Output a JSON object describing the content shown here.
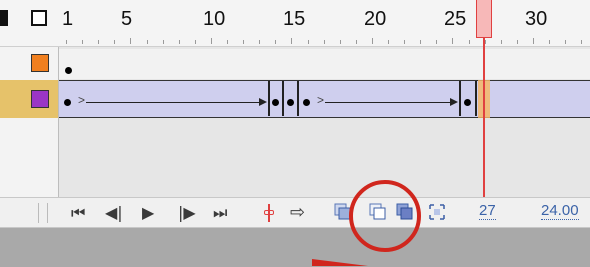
{
  "ruler": {
    "labels": [
      "1",
      "5",
      "10",
      "15",
      "20",
      "25",
      "30"
    ]
  },
  "layers": [
    {
      "color": "#f07f1f"
    },
    {
      "color": "#9b36c5"
    }
  ],
  "toolbar": {
    "current_frame": "27",
    "frame_rate": "24.00"
  },
  "colors": {
    "playhead": "#e04040",
    "tween_fill": "#cfcfee",
    "selected_layer": "#e6c26a",
    "annotation": "#d0261d"
  }
}
